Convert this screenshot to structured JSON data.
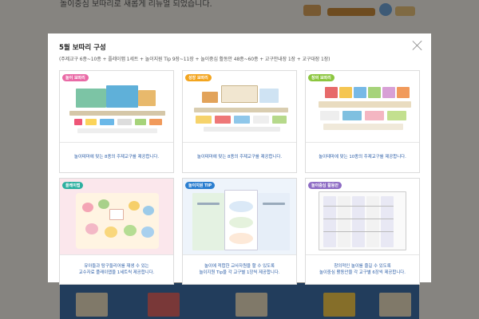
{
  "background": {
    "top_text": "놀이중심 보따리로 새롭게 리뉴얼 되었습니다."
  },
  "modal": {
    "title": "5월 보따리 구성",
    "subtitle": "(주제교구 6종~10종 + 플레이맵 1세트 + 놀이지원 Tip 9장~11장 + 놀이중심 활동안 48종~60종 + 교구안내장 1장 + 교구대장 1장)",
    "close_icon": "close-icon",
    "cards": [
      {
        "badge": "놀이 보따리",
        "badge_color": "#e96aa6",
        "desc_lines": [
          "놀이테마에 맞는 8종의 주제교구를 제공합니다."
        ]
      },
      {
        "badge": "성장 보따리",
        "badge_color": "#f3a51f",
        "desc_lines": [
          "놀이테마에 맞는 8종의 주제교구를 제공합니다."
        ]
      },
      {
        "badge": "창의 보따리",
        "badge_color": "#8cc63f",
        "desc_lines": [
          "놀이테마에 맞는 10종의 주제교구를 제공합니다."
        ]
      },
      {
        "badge": "플레이맵",
        "badge_color": "#2db0a0",
        "desc_lines": [
          "유아들과 탐구들리어를 재생 수 있는",
          "교수자료 플레이맵을 1세트씩 제공합니다."
        ]
      },
      {
        "badge": "놀이지원 TIP",
        "badge_color": "#2c7fd0",
        "desc_lines": [
          "놀이에 적합한 교사자원을 할 수 있도록",
          "놀이지원 Tip을 각 교구별 1장씩 제공합니다."
        ]
      },
      {
        "badge": "놀이중심 활동안",
        "badge_color": "#8e6cc4",
        "desc_lines": [
          "창의적인 놀이를 즐길 수 있도록",
          "놀이중심 활동안을 각 교구별 6장씩 제공합니다."
        ]
      }
    ]
  }
}
